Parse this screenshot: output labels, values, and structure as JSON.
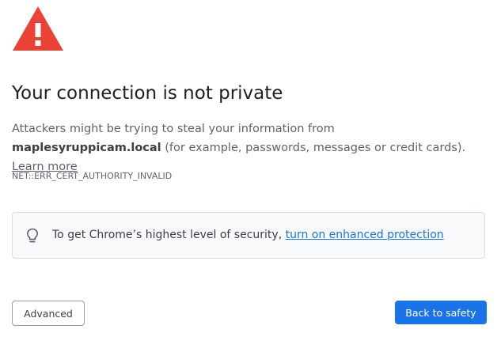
{
  "warning": {
    "icon": "warning-triangle-icon",
    "color": "#ea4335"
  },
  "title": "Your connection is not private",
  "description": {
    "before": "Attackers might be trying to steal your information from ",
    "domain": "maplesyruppicam.local",
    "after": " (for example, passwords, messages or credit cards). ",
    "learn_more": "Learn more"
  },
  "error_code": "NET::ERR_CERT_AUTHORITY_INVALID",
  "security_box": {
    "icon": "lightbulb-icon",
    "text": "To get Chrome’s highest level of security, ",
    "link": "turn on enhanced protection"
  },
  "buttons": {
    "advanced": "Advanced",
    "back_to_safety": "Back to safety"
  },
  "colors": {
    "primary": "#1a73e8",
    "warning": "#ea4335"
  }
}
